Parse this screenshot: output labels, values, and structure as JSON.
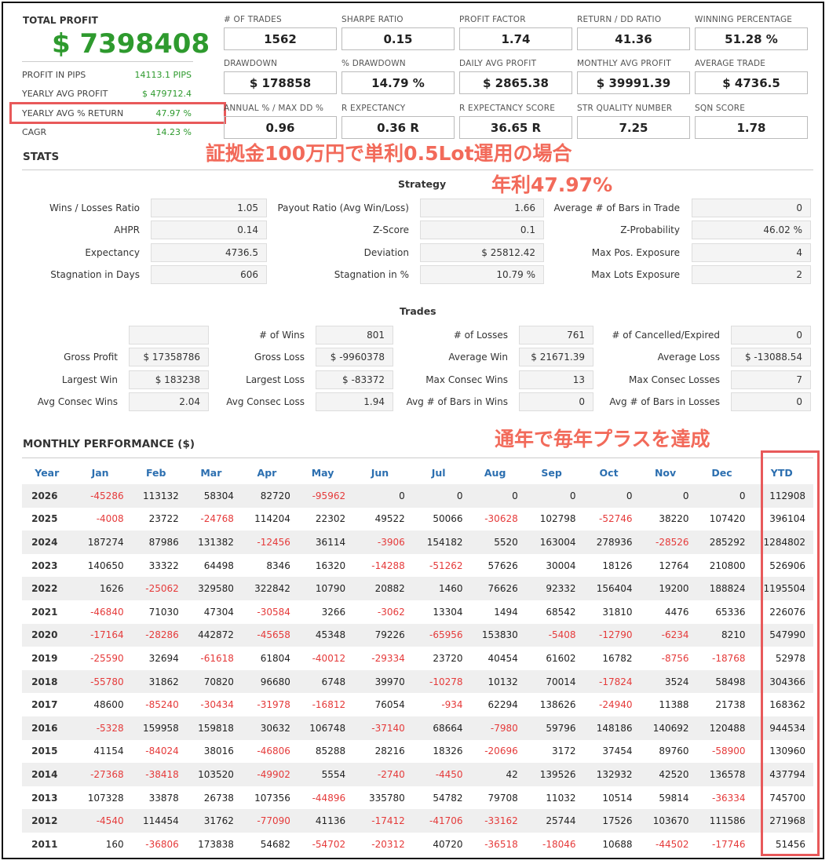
{
  "summary": {
    "total_profit_label": "TOTAL PROFIT",
    "total_profit_value": "$ 7398408",
    "rows": [
      {
        "label": "PROFIT IN PIPS",
        "value": "14113.1 PIPS"
      },
      {
        "label": "YEARLY AVG PROFIT",
        "value": "$ 479712.4"
      },
      {
        "label": "YEARLY AVG % RETURN",
        "value": "47.97 %"
      },
      {
        "label": "CAGR",
        "value": "14.23 %"
      }
    ]
  },
  "metrics": [
    {
      "label": "# OF TRADES",
      "value": "1562"
    },
    {
      "label": "SHARPE RATIO",
      "value": "0.15"
    },
    {
      "label": "PROFIT FACTOR",
      "value": "1.74"
    },
    {
      "label": "RETURN / DD RATIO",
      "value": "41.36"
    },
    {
      "label": "WINNING PERCENTAGE",
      "value": "51.28 %"
    },
    {
      "label": "DRAWDOWN",
      "value": "$ 178858"
    },
    {
      "label": "% DRAWDOWN",
      "value": "14.79 %"
    },
    {
      "label": "DAILY AVG PROFIT",
      "value": "$ 2865.38"
    },
    {
      "label": "MONTHLY AVG PROFIT",
      "value": "$ 39991.39"
    },
    {
      "label": "AVERAGE TRADE",
      "value": "$ 4736.5"
    },
    {
      "label": "ANNUAL % / MAX DD %",
      "value": "0.96"
    },
    {
      "label": "R EXPECTANCY",
      "value": "0.36 R"
    },
    {
      "label": "R EXPECTANCY SCORE",
      "value": "36.65 R"
    },
    {
      "label": "STR QUALITY NUMBER",
      "value": "7.25"
    },
    {
      "label": "SQN SCORE",
      "value": "1.78"
    }
  ],
  "annotations": {
    "line1": "証拠金100万円で単利0.5Lot運用の場合",
    "line2": "年利47.97%",
    "line3": "通年で毎年プラスを達成"
  },
  "stats": {
    "title": "STATS",
    "strategy_title": "Strategy",
    "strategy": [
      {
        "label": "Wins / Losses Ratio",
        "value": "1.05"
      },
      {
        "label": "Payout Ratio (Avg Win/Loss)",
        "value": "1.66"
      },
      {
        "label": "Average # of Bars in Trade",
        "value": "0"
      },
      {
        "label": "AHPR",
        "value": "0.14"
      },
      {
        "label": "Z-Score",
        "value": "0.1"
      },
      {
        "label": "Z-Probability",
        "value": "46.02 %"
      },
      {
        "label": "Expectancy",
        "value": "4736.5"
      },
      {
        "label": "Deviation",
        "value": "$ 25812.42"
      },
      {
        "label": "Max Pos. Exposure",
        "value": "4"
      },
      {
        "label": "Stagnation in Days",
        "value": "606"
      },
      {
        "label": "Stagnation in %",
        "value": "10.79 %"
      },
      {
        "label": "Max Lots Exposure",
        "value": "2"
      }
    ],
    "trades_title": "Trades",
    "trades": [
      {
        "label": "",
        "value": ""
      },
      {
        "label": "# of Wins",
        "value": "801"
      },
      {
        "label": "# of Losses",
        "value": "761"
      },
      {
        "label": "# of Cancelled/Expired",
        "value": "0"
      },
      {
        "label": "Gross Profit",
        "value": "$ 17358786"
      },
      {
        "label": "Gross Loss",
        "value": "$ -9960378"
      },
      {
        "label": "Average Win",
        "value": "$ 21671.39"
      },
      {
        "label": "Average Loss",
        "value": "$ -13088.54"
      },
      {
        "label": "Largest Win",
        "value": "$ 183238"
      },
      {
        "label": "Largest Loss",
        "value": "$ -83372"
      },
      {
        "label": "Max Consec Wins",
        "value": "13"
      },
      {
        "label": "Max Consec Losses",
        "value": "7"
      },
      {
        "label": "Avg Consec Wins",
        "value": "2.04"
      },
      {
        "label": "Avg Consec Loss",
        "value": "1.94"
      },
      {
        "label": "Avg # of Bars in Wins",
        "value": "0"
      },
      {
        "label": "Avg # of Bars in Losses",
        "value": "0"
      }
    ]
  },
  "monthly": {
    "title": "MONTHLY PERFORMANCE ($)",
    "headers": [
      "Year",
      "Jan",
      "Feb",
      "Mar",
      "Apr",
      "May",
      "Jun",
      "Jul",
      "Aug",
      "Sep",
      "Oct",
      "Nov",
      "Dec",
      "YTD"
    ],
    "rows": [
      [
        "2026",
        "-45286",
        "113132",
        "58304",
        "82720",
        "-95962",
        "0",
        "0",
        "0",
        "0",
        "0",
        "0",
        "0",
        "112908"
      ],
      [
        "2025",
        "-4008",
        "23722",
        "-24768",
        "114204",
        "22302",
        "49522",
        "50066",
        "-30628",
        "102798",
        "-52746",
        "38220",
        "107420",
        "396104"
      ],
      [
        "2024",
        "187274",
        "87986",
        "131382",
        "-12456",
        "36114",
        "-3906",
        "154182",
        "5520",
        "163004",
        "278936",
        "-28526",
        "285292",
        "1284802"
      ],
      [
        "2023",
        "140650",
        "33322",
        "64498",
        "8346",
        "16320",
        "-14288",
        "-51262",
        "57626",
        "30004",
        "18126",
        "12764",
        "210800",
        "526906"
      ],
      [
        "2022",
        "1626",
        "-25062",
        "329580",
        "322842",
        "10790",
        "20882",
        "1460",
        "76626",
        "92332",
        "156404",
        "19200",
        "188824",
        "1195504"
      ],
      [
        "2021",
        "-46840",
        "71030",
        "47304",
        "-30584",
        "3266",
        "-3062",
        "13304",
        "1494",
        "68542",
        "31810",
        "4476",
        "65336",
        "226076"
      ],
      [
        "2020",
        "-17164",
        "-28286",
        "442872",
        "-45658",
        "45348",
        "79226",
        "-65956",
        "153830",
        "-5408",
        "-12790",
        "-6234",
        "8210",
        "547990"
      ],
      [
        "2019",
        "-25590",
        "32694",
        "-61618",
        "61804",
        "-40012",
        "-29334",
        "23720",
        "40454",
        "61602",
        "16782",
        "-8756",
        "-18768",
        "52978"
      ],
      [
        "2018",
        "-55780",
        "31862",
        "70820",
        "96680",
        "6748",
        "39970",
        "-10278",
        "10132",
        "70014",
        "-17824",
        "3524",
        "58498",
        "304366"
      ],
      [
        "2017",
        "48600",
        "-85240",
        "-30434",
        "-31978",
        "-16812",
        "76054",
        "-934",
        "62294",
        "138626",
        "-24940",
        "11388",
        "21738",
        "168362"
      ],
      [
        "2016",
        "-5328",
        "159958",
        "159818",
        "30632",
        "106748",
        "-37140",
        "68664",
        "-7980",
        "59796",
        "148186",
        "140692",
        "120488",
        "944534"
      ],
      [
        "2015",
        "41154",
        "-84024",
        "38016",
        "-46806",
        "85288",
        "28216",
        "18326",
        "-20696",
        "3172",
        "37454",
        "89760",
        "-58900",
        "130960"
      ],
      [
        "2014",
        "-27368",
        "-38418",
        "103520",
        "-49902",
        "5554",
        "-2740",
        "-4450",
        "42",
        "139526",
        "132932",
        "42520",
        "136578",
        "437794"
      ],
      [
        "2013",
        "107328",
        "33878",
        "26738",
        "107356",
        "-44896",
        "335780",
        "54782",
        "79708",
        "11032",
        "10514",
        "59814",
        "-36334",
        "745700"
      ],
      [
        "2012",
        "-4540",
        "114454",
        "31762",
        "-77090",
        "41136",
        "-17412",
        "-41706",
        "-33162",
        "25744",
        "17526",
        "103670",
        "111586",
        "271968"
      ],
      [
        "2011",
        "160",
        "-36806",
        "173838",
        "54682",
        "-54702",
        "-20312",
        "40720",
        "-36518",
        "-18046",
        "10688",
        "-44502",
        "-17746",
        "51456"
      ]
    ]
  },
  "colors": {
    "positive": "#2e9a2e",
    "negative": "#e53a3a",
    "header_blue": "#2c6fb0",
    "highlight": "#e8595a"
  }
}
